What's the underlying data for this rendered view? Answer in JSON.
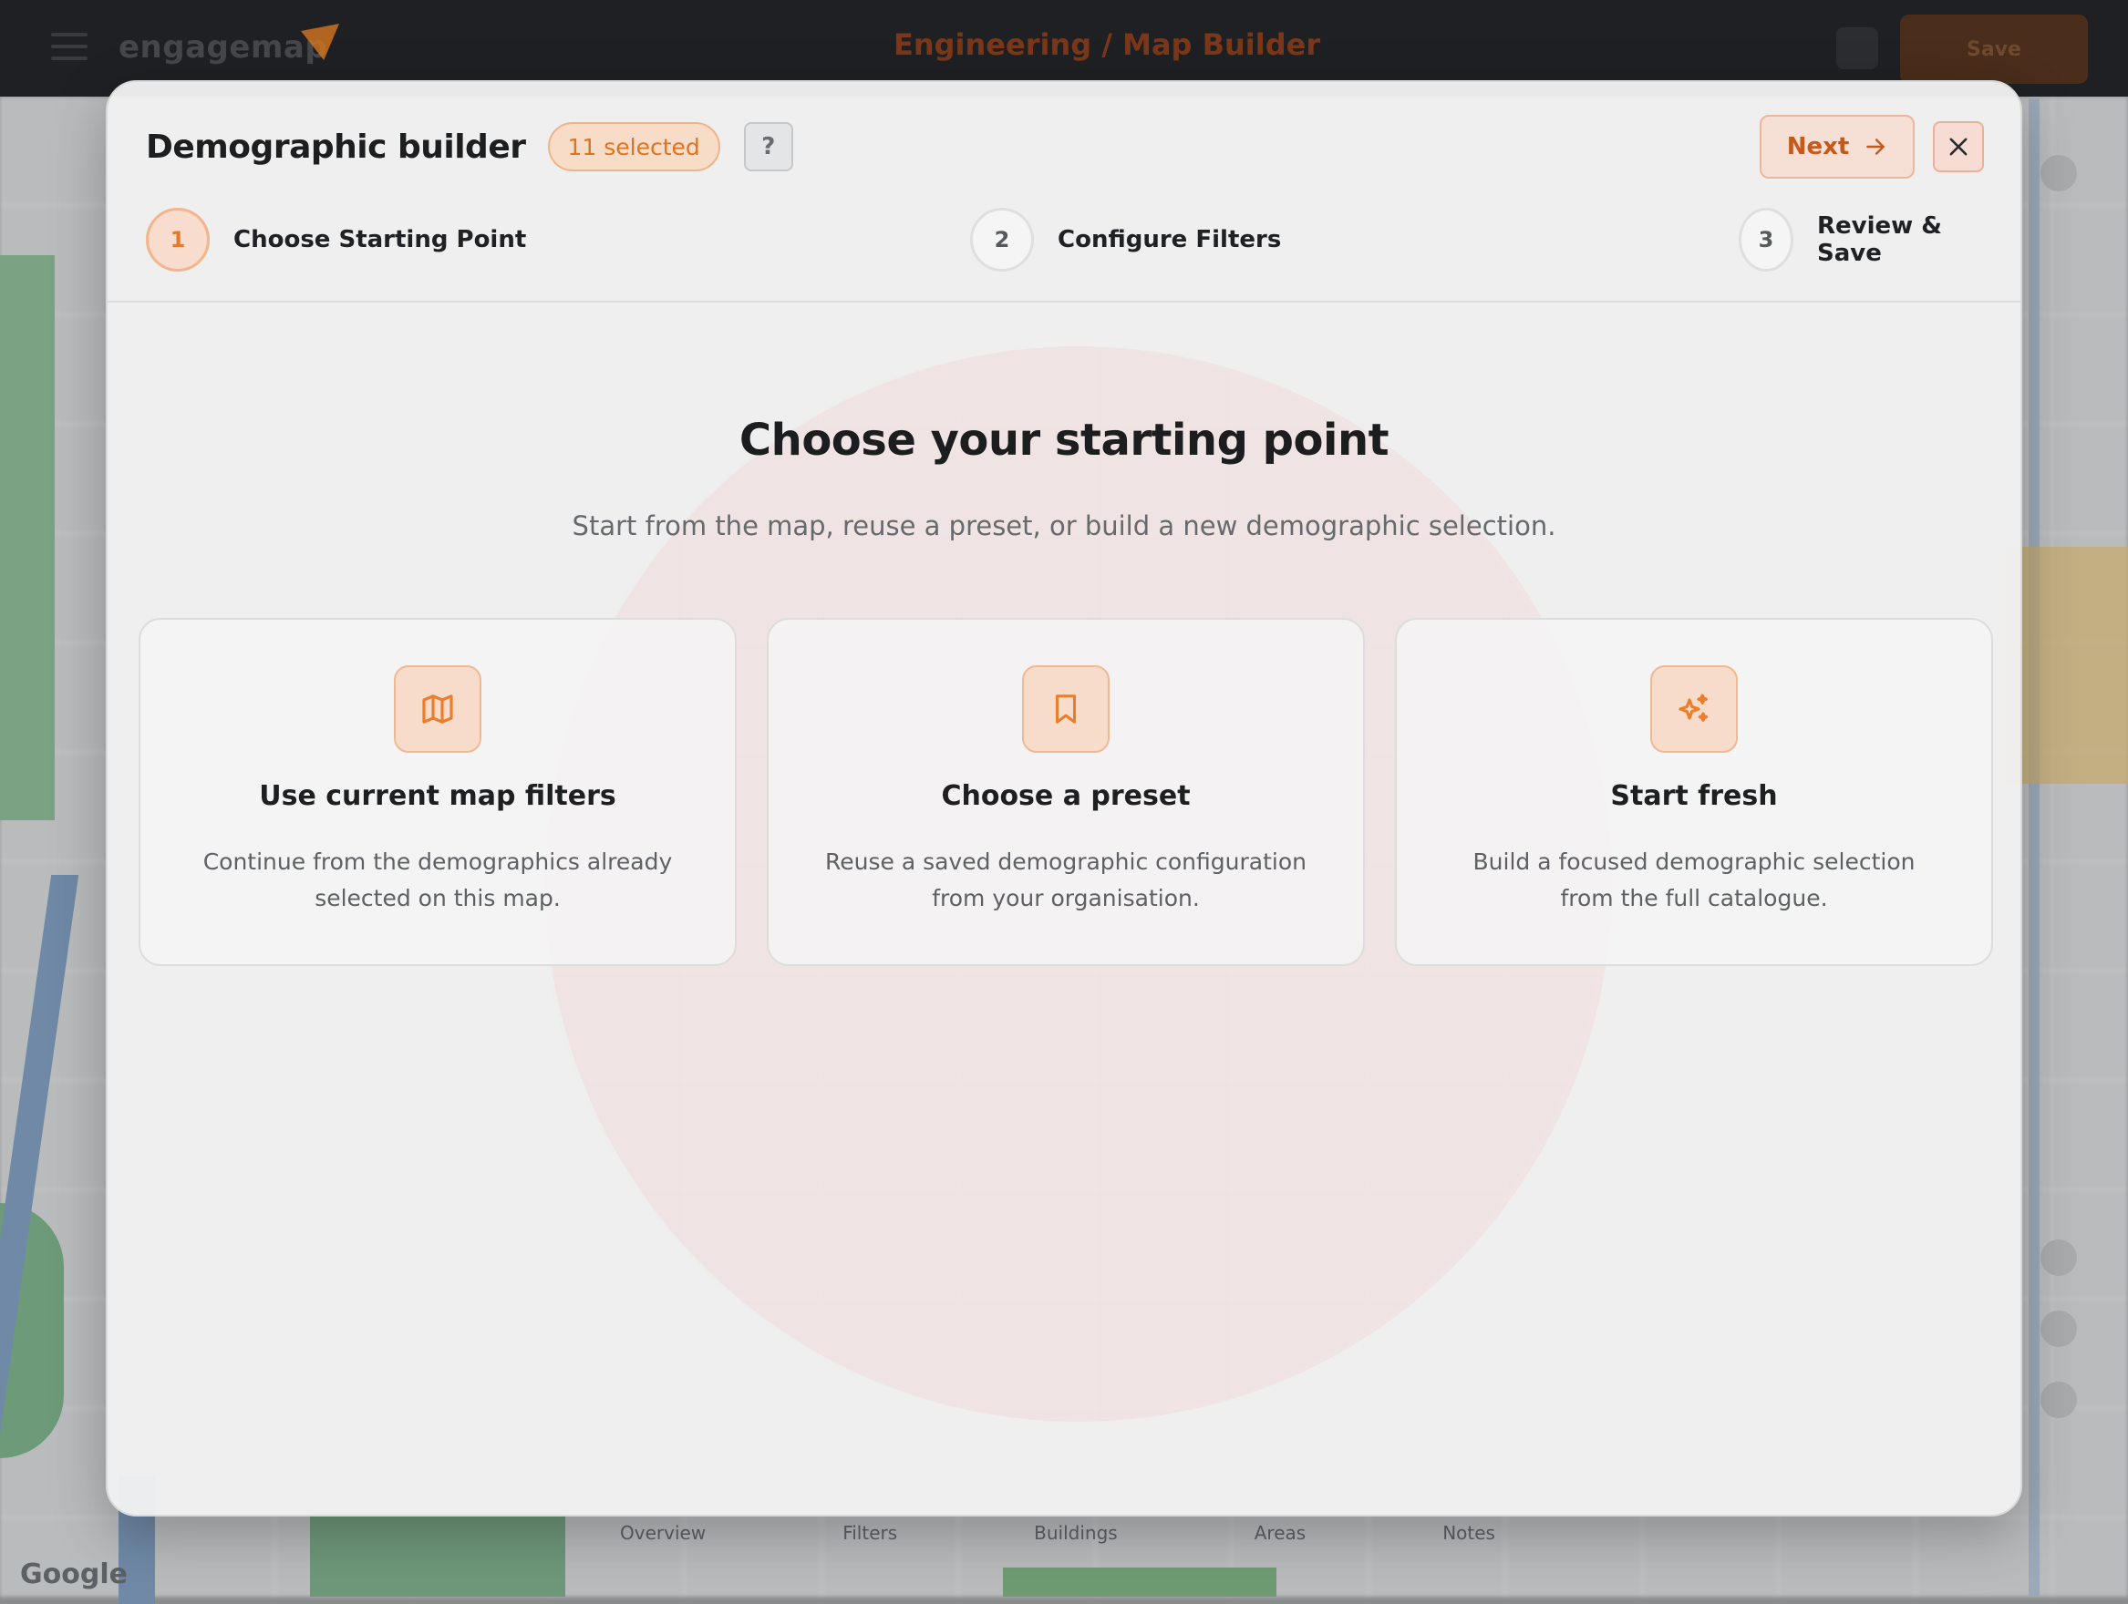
{
  "background": {
    "app_title": "Engineering / Map Builder",
    "save_label": "Save",
    "map_tabs": [
      "Overview",
      "Filters",
      "Buildings",
      "Areas",
      "Notes"
    ],
    "google_label": "Google"
  },
  "modal": {
    "title": "Demographic builder",
    "selected_badge": "11 selected",
    "help_label": "?",
    "next_label": "Next",
    "close_icon": "close-icon"
  },
  "stepper": {
    "steps": [
      {
        "number": "1",
        "label": "Choose Starting Point",
        "state": "active"
      },
      {
        "number": "2",
        "label": "Configure Filters",
        "state": "inactive"
      },
      {
        "number": "3",
        "label": "Review & Save",
        "state": "inactive"
      }
    ]
  },
  "main": {
    "heading": "Choose your starting point",
    "subheading": "Start from the map, reuse a preset, or build a new demographic selection."
  },
  "cards": [
    {
      "icon": "map-icon",
      "title": "Use current map filters",
      "description": "Continue from the demographics already selected on this map."
    },
    {
      "icon": "bookmark-icon",
      "title": "Choose a preset",
      "description": "Reuse a saved demographic configuration from your organisation."
    },
    {
      "icon": "sparkles-icon",
      "title": "Start fresh",
      "description": "Build a focused demographic selection from the full catalogue."
    }
  ],
  "colors": {
    "accent": "#e67a2a",
    "accent_dark": "#c55a1d",
    "accent_soft": "#f8dccb"
  }
}
